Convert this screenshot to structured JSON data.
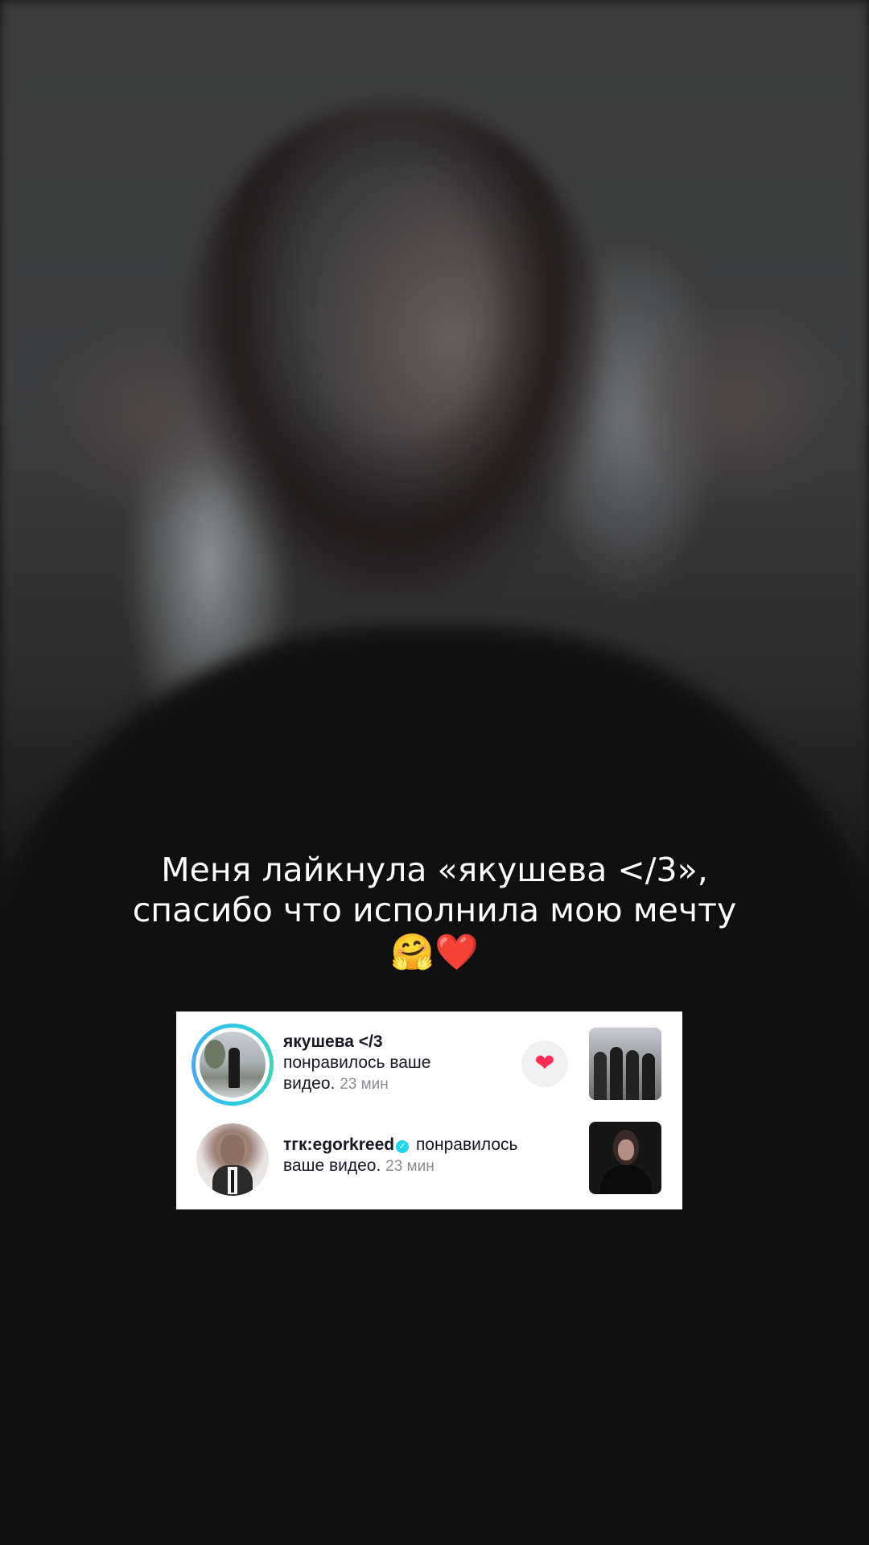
{
  "caption": {
    "line1": "Меня лайкнула «якушева </3»,",
    "line2": "спасибо что исполнила мою мечту",
    "emojis": "🤗❤️"
  },
  "notifications": [
    {
      "username": "якушева </3",
      "action": "понравилось ваше видео.",
      "time": "23 мин",
      "has_story_ring": true,
      "liked_back": true,
      "like_icon": "heart-icon"
    },
    {
      "username": "тгк:egorkreed",
      "verified": true,
      "verified_icon": "verified-badge-icon",
      "action": "понравилось ваше видео.",
      "time": "23 мин"
    }
  ],
  "colors": {
    "like_red": "#fe2c55",
    "verified_blue": "#20d5ec",
    "story_ring": "#2ec7e6"
  }
}
